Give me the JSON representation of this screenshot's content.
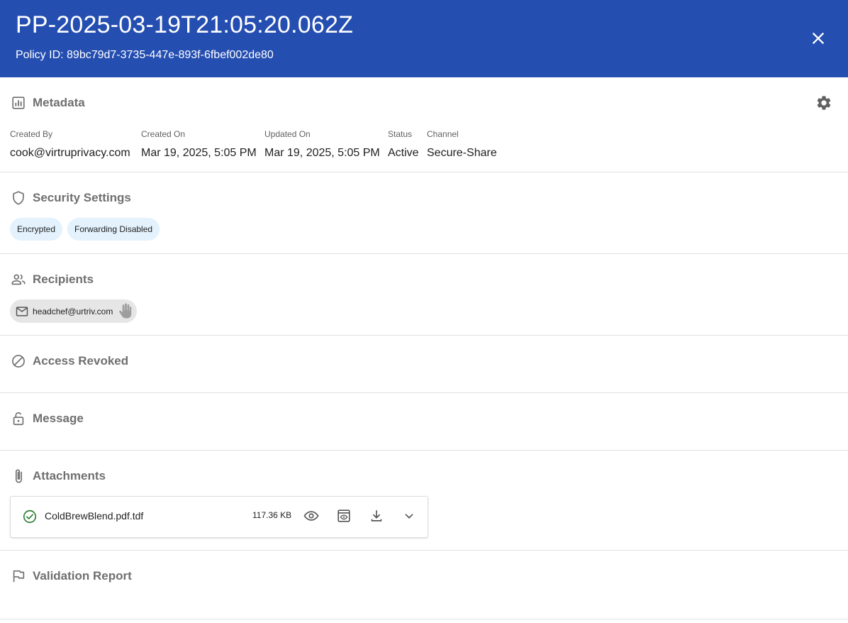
{
  "header": {
    "title": "PP-2025-03-19T21:05:20.062Z",
    "policy_id": "Policy ID: 89bc79d7-3735-447e-893f-6fbef002de80",
    "background_color": "#254eb1",
    "close_icon": "close-icon"
  },
  "metadata": {
    "title": "Metadata",
    "icon": "chart-icon",
    "settings_icon": "gear-icon",
    "fields": [
      {
        "label": "Created By",
        "value": "cook@virtruprivacy.com"
      },
      {
        "label": "Created On",
        "value": "Mar 19, 2025, 5:05 PM"
      },
      {
        "label": "Updated On",
        "value": "Mar 19, 2025, 5:05 PM"
      },
      {
        "label": "Status",
        "value": "Active"
      },
      {
        "label": "Channel",
        "value": "Secure-Share"
      }
    ]
  },
  "security": {
    "title": "Security Settings",
    "icon": "shield-icon",
    "chips": [
      "Encrypted",
      "Forwarding Disabled"
    ],
    "chip_color": "#e3f2fd"
  },
  "recipients": {
    "title": "Recipients",
    "icon": "people-icon",
    "items": [
      {
        "email": "headchef@urtriv.com",
        "icon": "mail-icon",
        "action_icon": "hand-icon"
      }
    ]
  },
  "access_revoked": {
    "title": "Access Revoked",
    "icon": "block-icon"
  },
  "message": {
    "title": "Message",
    "icon": "lock-icon"
  },
  "attachments": {
    "title": "Attachments",
    "icon": "paperclip-icon",
    "files": [
      {
        "name": "ColdBrewBlend.pdf.tdf",
        "size": "117.36 KB",
        "status_icon": "check-circle-icon",
        "status_color": "#2e7d32",
        "actions": [
          "eye-icon",
          "preview-icon",
          "download-icon",
          "chevron-down-icon"
        ]
      }
    ]
  },
  "validation": {
    "title": "Validation Report",
    "icon": "flag-icon"
  }
}
